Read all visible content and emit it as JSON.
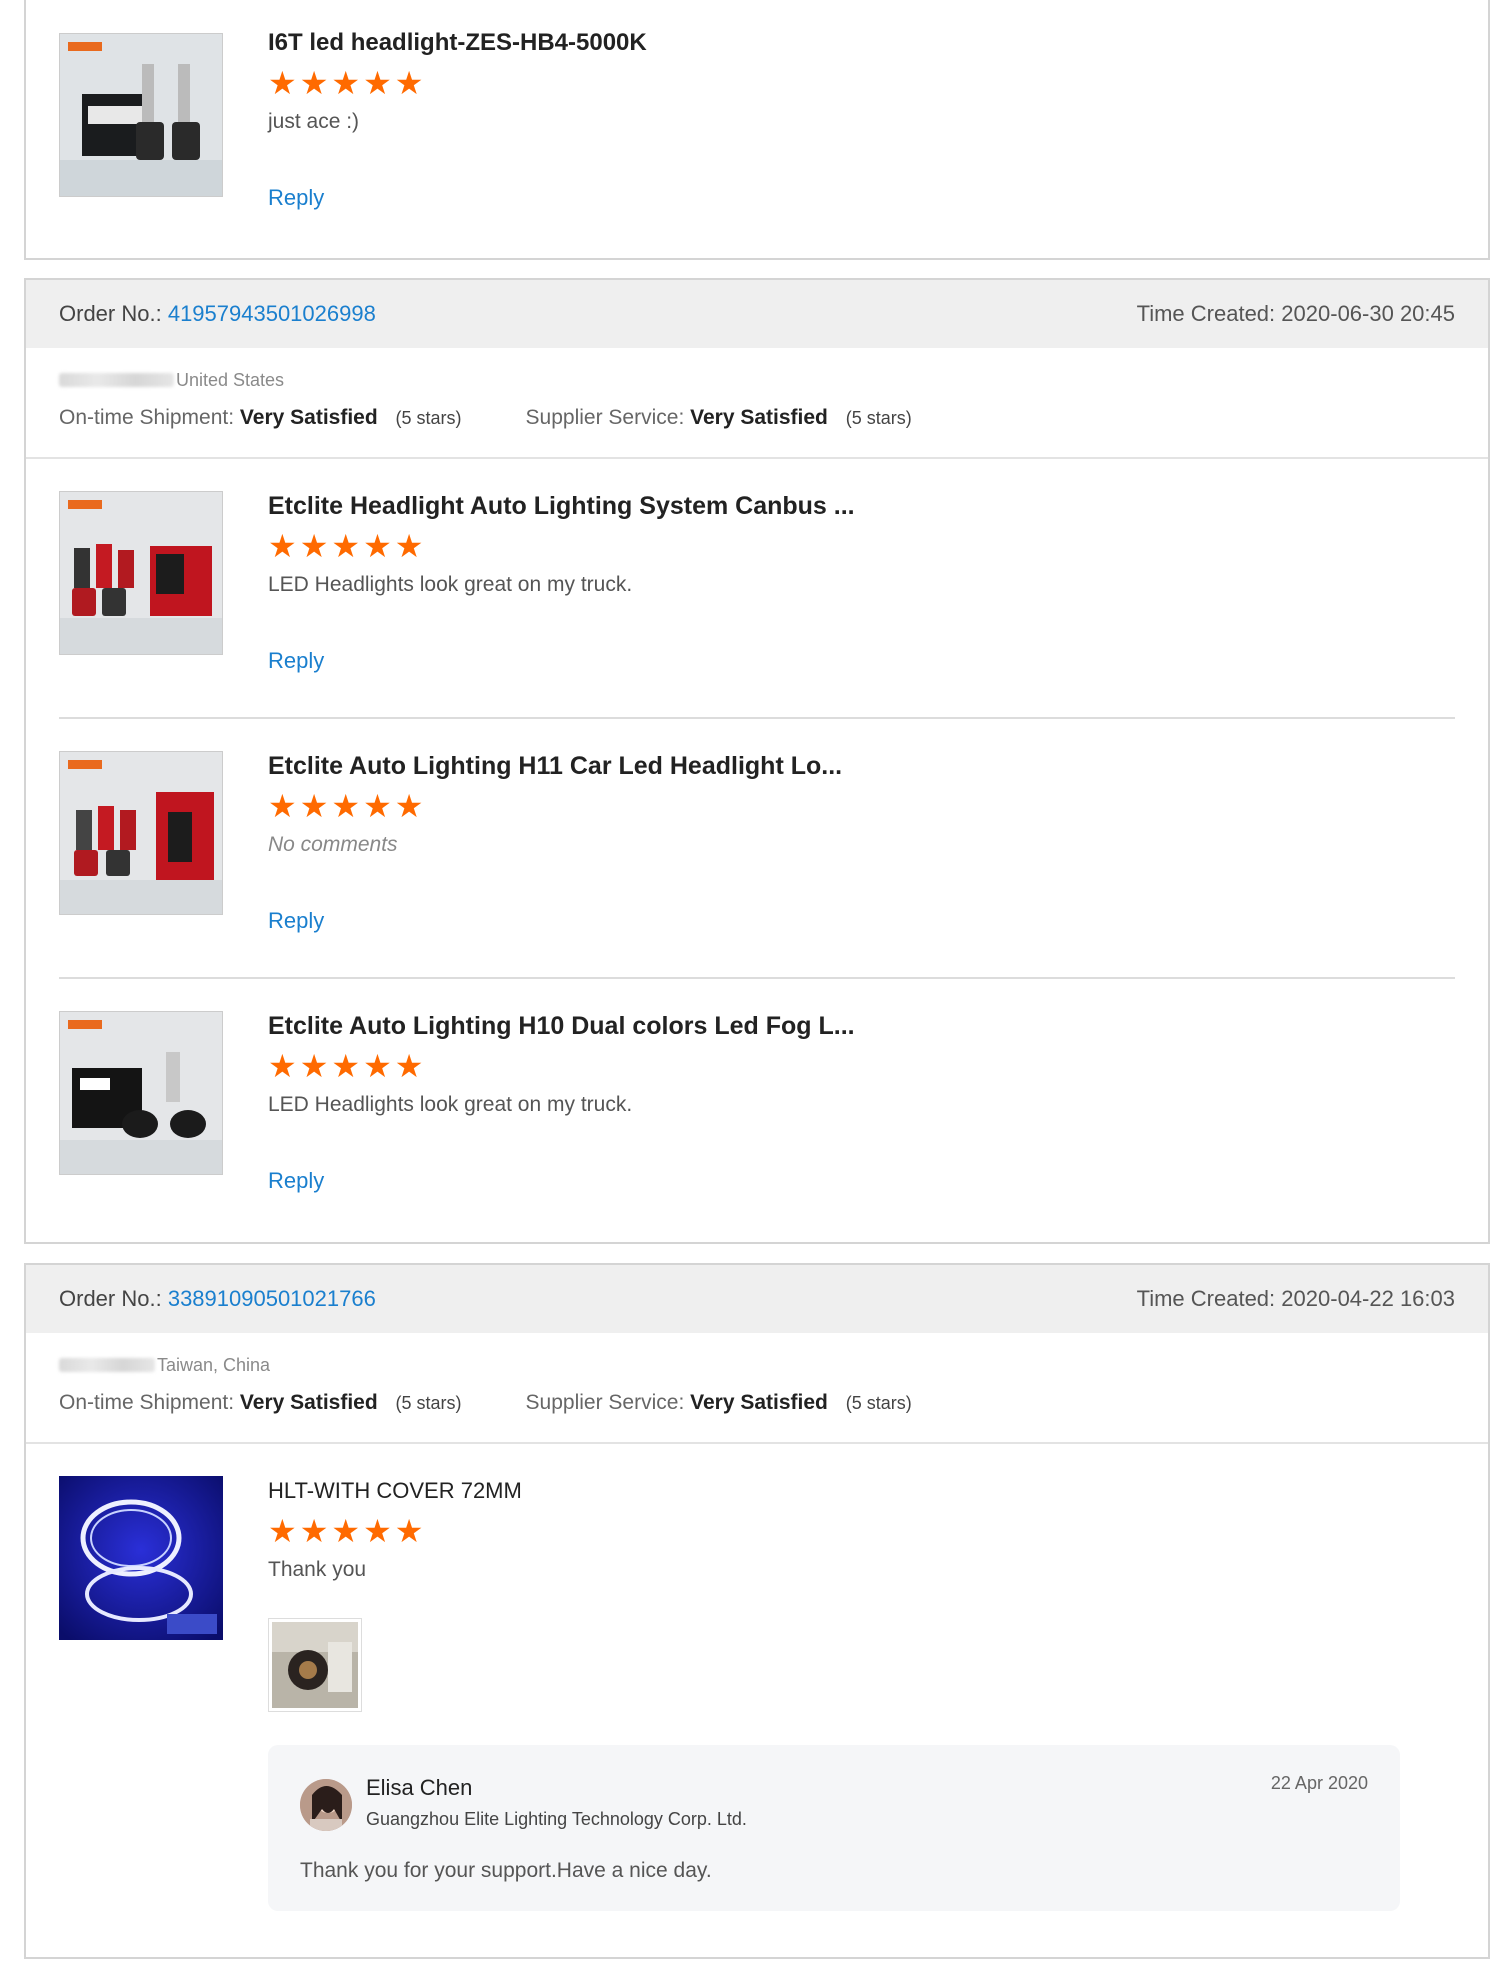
{
  "reviews": [
    {
      "items": [
        {
          "title": "I6T led headlight-ZES-HB4-5000K",
          "stars": "★★★★★",
          "comment": "just ace :)",
          "reply": "Reply"
        }
      ]
    },
    {
      "order_label": "Order No.:",
      "order_no": "41957943501026998",
      "time_label": "Time Created:",
      "time": "2020-06-30 20:45",
      "country": "United States",
      "shipment_label": "On-time Shipment:",
      "shipment_value": "Very Satisfied",
      "shipment_stars": "(5 stars)",
      "service_label": "Supplier Service:",
      "service_value": "Very Satisfied",
      "service_stars": "(5 stars)",
      "items": [
        {
          "title": "Etclite Headlight Auto Lighting System Canbus ...",
          "stars": "★★★★★",
          "comment": "LED Headlights look great on my truck.",
          "reply": "Reply"
        },
        {
          "title": "Etclite Auto Lighting H11 Car Led Headlight Lo...",
          "stars": "★★★★★",
          "comment": "No comments",
          "reply": "Reply"
        },
        {
          "title": "Etclite Auto Lighting H10 Dual colors Led Fog L...",
          "stars": "★★★★★",
          "comment": "LED Headlights look great on my truck.",
          "reply": "Reply"
        }
      ]
    },
    {
      "order_label": "Order No.:",
      "order_no": "33891090501021766",
      "time_label": "Time Created:",
      "time": "2020-04-22 16:03",
      "country": "Taiwan, China",
      "shipment_label": "On-time Shipment:",
      "shipment_value": "Very Satisfied",
      "shipment_stars": "(5 stars)",
      "service_label": "Supplier Service:",
      "service_value": "Very Satisfied",
      "service_stars": "(5 stars)",
      "items": [
        {
          "title": "HLT-WITH COVER 72MM",
          "stars": "★★★★★",
          "comment": "Thank you"
        }
      ],
      "supplier_reply": {
        "name": "Elisa Chen",
        "company": "Guangzhou Elite Lighting Technology Corp. Ltd.",
        "date": "22 Apr 2020",
        "text": "Thank you for your support.Have a nice day."
      }
    }
  ],
  "colors": {
    "link": "#1a7fce",
    "star": "#ff6a00",
    "header_bg": "#efefef"
  },
  "icons": {
    "rating": "star-icon"
  }
}
